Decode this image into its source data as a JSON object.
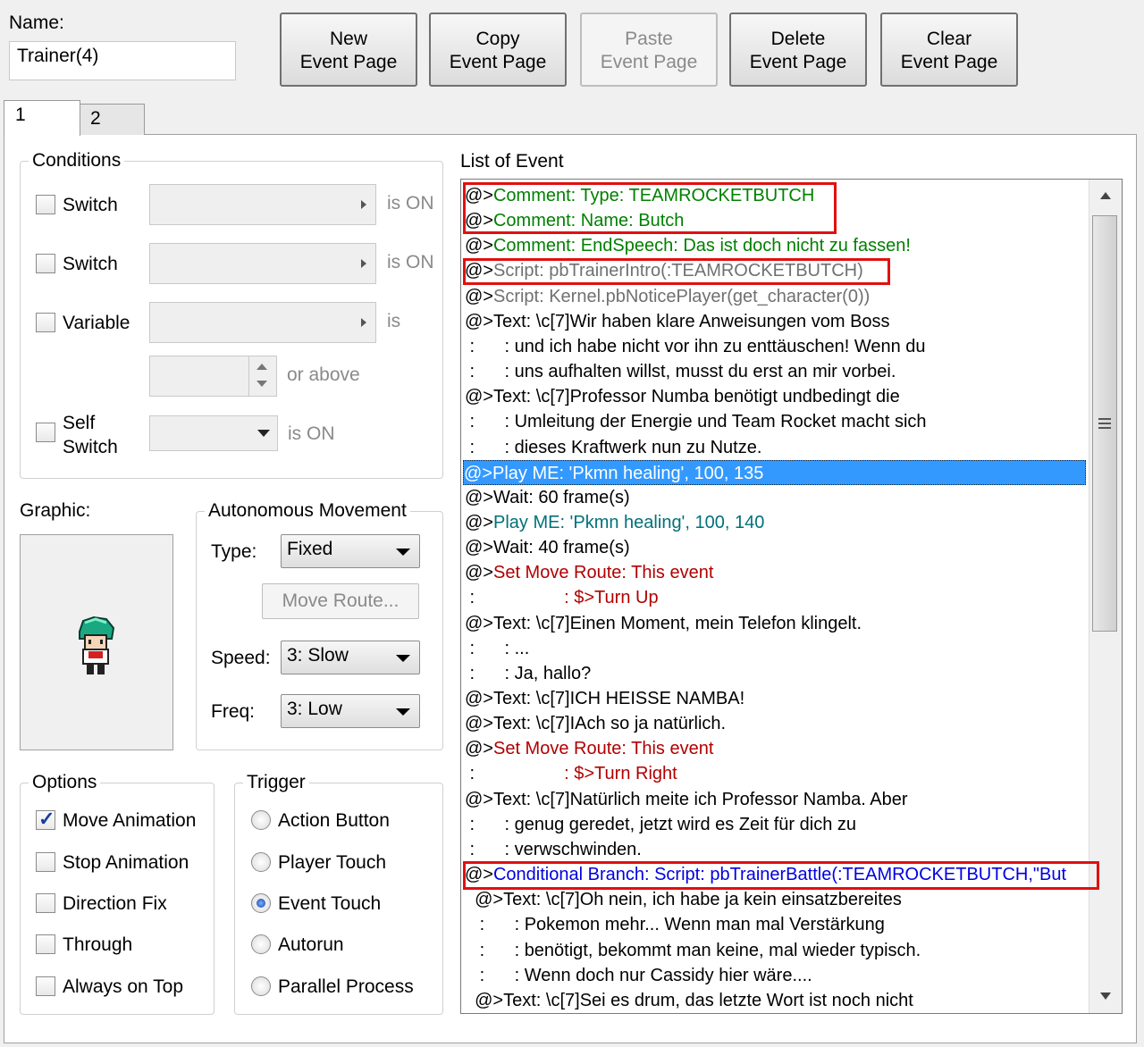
{
  "header": {
    "name_label": "Name:",
    "name_value": "Trainer(4)",
    "buttons": [
      {
        "line1": "New",
        "line2": "Event Page",
        "enabled": true
      },
      {
        "line1": "Copy",
        "line2": "Event Page",
        "enabled": true
      },
      {
        "line1": "Paste",
        "line2": "Event Page",
        "enabled": false
      },
      {
        "line1": "Delete",
        "line2": "Event Page",
        "enabled": true
      },
      {
        "line1": "Clear",
        "line2": "Event Page",
        "enabled": true
      }
    ]
  },
  "tabs": [
    {
      "label": "1"
    },
    {
      "label": "2"
    }
  ],
  "conditions": {
    "title": "Conditions",
    "switch1": {
      "label": "Switch",
      "suffix": "is ON"
    },
    "switch2": {
      "label": "Switch",
      "suffix": "is ON"
    },
    "variable": {
      "label": "Variable",
      "suffix": "is",
      "or_above": "or above"
    },
    "self_switch": {
      "line1": "Self",
      "line2": "Switch",
      "suffix": "is ON"
    }
  },
  "graphic": {
    "label": "Graphic:"
  },
  "autonomous": {
    "title": "Autonomous Movement",
    "type_label": "Type:",
    "type_value": "Fixed",
    "move_route_button": "Move Route...",
    "speed_label": "Speed:",
    "speed_value": "3: Slow",
    "freq_label": "Freq:",
    "freq_value": "3: Low"
  },
  "options": {
    "title": "Options",
    "items": [
      {
        "label": "Move Animation",
        "checked": true
      },
      {
        "label": "Stop Animation",
        "checked": false
      },
      {
        "label": "Direction Fix",
        "checked": false
      },
      {
        "label": "Through",
        "checked": false
      },
      {
        "label": "Always on Top",
        "checked": false
      }
    ]
  },
  "trigger": {
    "title": "Trigger",
    "items": [
      {
        "label": "Action Button",
        "selected": false
      },
      {
        "label": "Player Touch",
        "selected": false
      },
      {
        "label": "Event Touch",
        "selected": true
      },
      {
        "label": "Autorun",
        "selected": false
      },
      {
        "label": "Parallel Process",
        "selected": false
      }
    ]
  },
  "event_list": {
    "title": "List of Event",
    "lines": [
      {
        "prefix": "@>",
        "text": "Comment: Type: TEAMROCKETBUTCH",
        "color": "green"
      },
      {
        "prefix": "@>",
        "text": "Comment: Name: Butch",
        "color": "green"
      },
      {
        "prefix": "@>",
        "text": "Comment: EndSpeech: Das ist doch nicht zu fassen!",
        "color": "green"
      },
      {
        "prefix": "@>",
        "text": "Script: pbTrainerIntro(:TEAMROCKETBUTCH)",
        "color": "gray"
      },
      {
        "prefix": "@>",
        "text": "Script: Kernel.pbNoticePlayer(get_character(0))",
        "color": "gray"
      },
      {
        "prefix": "@>",
        "text": "Text: \\c[7]Wir haben klare Anweisungen vom Boss",
        "color": "black"
      },
      {
        "prefix": " :",
        "text": "      : und ich habe nicht vor ihn zu enttäuschen! Wenn du",
        "color": "black"
      },
      {
        "prefix": " :",
        "text": "      : uns aufhalten willst, musst du erst an mir vorbei.",
        "color": "black"
      },
      {
        "prefix": "@>",
        "text": "Text: \\c[7]Professor Numba benötigt undbedingt die",
        "color": "black"
      },
      {
        "prefix": " :",
        "text": "      : Umleitung der Energie und Team Rocket macht sich",
        "color": "black"
      },
      {
        "prefix": " :",
        "text": "      : dieses Kraftwerk nun zu Nutze.",
        "color": "black"
      },
      {
        "prefix": "@>",
        "text": "Play ME: 'Pkmn healing', 100, 135",
        "color": "white"
      },
      {
        "prefix": "@>",
        "text": "Wait: 60 frame(s)",
        "color": "black"
      },
      {
        "prefix": "@>",
        "text": "Play ME: 'Pkmn healing', 100, 140",
        "color": "teal"
      },
      {
        "prefix": "@>",
        "text": "Wait: 40 frame(s)",
        "color": "black"
      },
      {
        "prefix": "@>",
        "text": "Set Move Route: This event",
        "color": "red"
      },
      {
        "prefix": " :",
        "text": "                  : $>Turn Up",
        "color": "red"
      },
      {
        "prefix": "@>",
        "text": "Text: \\c[7]Einen Moment, mein Telefon klingelt.",
        "color": "black"
      },
      {
        "prefix": " :",
        "text": "      : ...",
        "color": "black"
      },
      {
        "prefix": " :",
        "text": "      : Ja, hallo?",
        "color": "black"
      },
      {
        "prefix": "@>",
        "text": "Text: \\c[7]ICH HEISSE NAMBA!",
        "color": "black"
      },
      {
        "prefix": "@>",
        "text": "Text: \\c[7]IAch so ja natürlich.",
        "color": "black"
      },
      {
        "prefix": "@>",
        "text": "Set Move Route: This event",
        "color": "red"
      },
      {
        "prefix": " :",
        "text": "                  : $>Turn Right",
        "color": "red"
      },
      {
        "prefix": "@>",
        "text": "Text: \\c[7]Natürlich meite ich Professor Namba. Aber",
        "color": "black"
      },
      {
        "prefix": " :",
        "text": "      : genug geredet, jetzt wird es Zeit für dich zu",
        "color": "black"
      },
      {
        "prefix": " :",
        "text": "      : verwschwinden.",
        "color": "black"
      },
      {
        "prefix": "@>",
        "text": "Conditional Branch: Script: pbTrainerBattle(:TEAMROCKETBUTCH,\"But",
        "color": "blue"
      },
      {
        "prefix": "  @>",
        "text": "Text: \\c[7]Oh nein, ich habe ja kein einsatzbereites",
        "color": "black"
      },
      {
        "prefix": "   :",
        "text": "      : Pokemon mehr... Wenn man mal Verstärkung",
        "color": "black"
      },
      {
        "prefix": "   :",
        "text": "      : benötigt, bekommt man keine, mal wieder typisch.",
        "color": "black"
      },
      {
        "prefix": "   :",
        "text": "      : Wenn doch nur Cassidy hier wäre....",
        "color": "black"
      },
      {
        "prefix": "  @>",
        "text": "Text: \\c[7]Sei es drum, das letzte Wort ist noch nicht",
        "color": "black"
      }
    ],
    "selected_index": 11
  }
}
